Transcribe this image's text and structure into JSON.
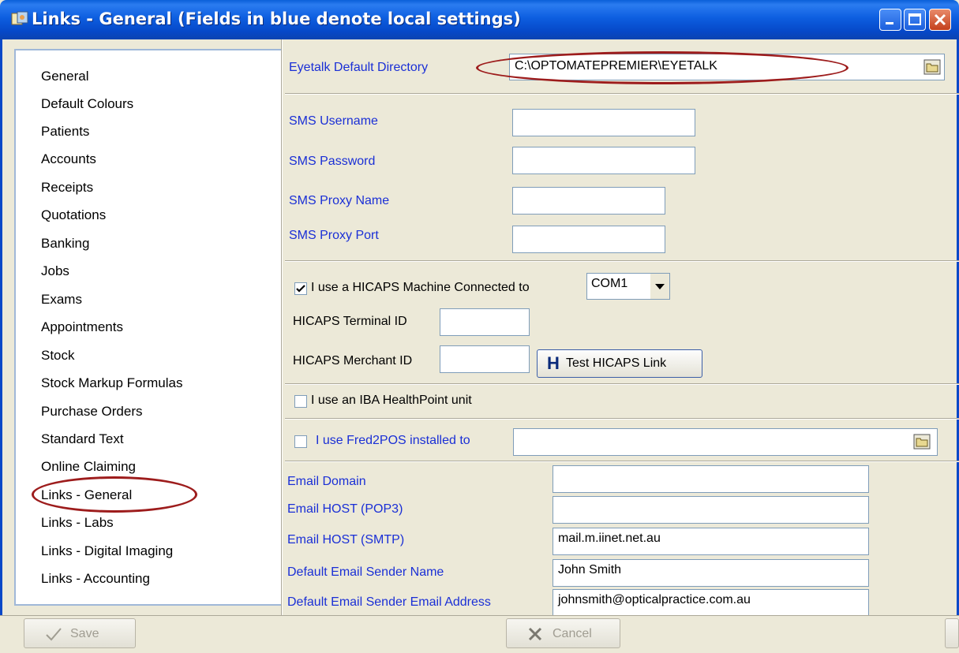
{
  "window": {
    "title": "Links - General (Fields in blue denote local settings)"
  },
  "nav": {
    "items": [
      {
        "label": "General"
      },
      {
        "label": "Default Colours"
      },
      {
        "label": "Patients"
      },
      {
        "label": "Accounts"
      },
      {
        "label": "Receipts"
      },
      {
        "label": "Quotations"
      },
      {
        "label": "Banking"
      },
      {
        "label": "Jobs"
      },
      {
        "label": "Exams"
      },
      {
        "label": "Appointments"
      },
      {
        "label": "Stock"
      },
      {
        "label": "Stock Markup Formulas"
      },
      {
        "label": "Purchase Orders"
      },
      {
        "label": "Standard Text"
      },
      {
        "label": "Online Claiming"
      },
      {
        "label": "Links - General",
        "selected": true
      },
      {
        "label": "Links - Labs"
      },
      {
        "label": "Links - Digital Imaging"
      },
      {
        "label": "Links - Accounting"
      }
    ]
  },
  "eyetalk": {
    "label": "Eyetalk Default Directory",
    "value": "C:\\OPTOMATEPREMIER\\EYETALK"
  },
  "sms": {
    "username_label": "SMS Username",
    "username_value": "",
    "password_label": "SMS Password",
    "password_value": "",
    "proxy_name_label": "SMS Proxy Name",
    "proxy_name_value": "",
    "proxy_port_label": "SMS Proxy Port",
    "proxy_port_value": ""
  },
  "hicaps": {
    "checkbox_label": "I use a HICAPS Machine Connected to",
    "checked": true,
    "port_value": "COM1",
    "terminal_label": "HICAPS Terminal ID",
    "terminal_value": "",
    "merchant_label": "HICAPS Merchant ID",
    "merchant_value": "",
    "test_button": "Test HICAPS Link"
  },
  "iba": {
    "checkbox_label": "I use an IBA HealthPoint unit",
    "checked": false
  },
  "fred2pos": {
    "checkbox_label": "I use Fred2POS installed to",
    "checked": false,
    "path_value": ""
  },
  "email": {
    "domain_label": "Email Domain",
    "domain_value": "",
    "pop3_label": "Email HOST (POP3)",
    "pop3_value": "",
    "smtp_label": "Email HOST (SMTP)",
    "smtp_value": "mail.m.iinet.net.au",
    "sender_name_label": "Default Email Sender Name",
    "sender_name_value": "John Smith",
    "sender_email_label": "Default Email Sender Email Address",
    "sender_email_value": "johnsmith@opticalpractice.com.au"
  },
  "footer": {
    "save_label": "Save",
    "cancel_label": "Cancel"
  },
  "colors": {
    "title_bar": "#0a5fd8",
    "local_setting_text": "#1a2fd6",
    "annotation_oval": "#9d1c1c"
  }
}
